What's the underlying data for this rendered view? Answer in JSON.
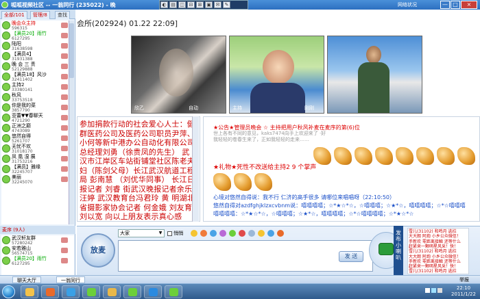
{
  "window": {
    "title": "呱呱视频社区 -- 一翁同行 (235022) - 晚",
    "network_status": "网络状况",
    "controls": [
      "—",
      "□",
      "×"
    ]
  },
  "toolbar": {
    "buttons": [
      "◐",
      "▤",
      "◫",
      "⊟",
      "⊞",
      "▣",
      "✉",
      "✎"
    ]
  },
  "left_panel": {
    "tabs": [
      "全部/101",
      "管理/8",
      "查找"
    ],
    "users": [
      {
        "name": "晚会众主持",
        "id": "596315",
        "color": "#d00"
      },
      {
        "name": "【满员20】雨竹",
        "id": "6127295",
        "color": "#0a0"
      },
      {
        "name": "陆阳",
        "id": "31638598",
        "color": "#000"
      },
      {
        "name": "【满员4】",
        "id": "31931388",
        "color": "#000"
      },
      {
        "name": "晚 会 三 责",
        "id": "52129888",
        "color": "#000"
      },
      {
        "name": "【满员18】风沙",
        "id": "32411402",
        "color": "#000"
      },
      {
        "name": "主持2",
        "id": "33380141",
        "color": "#000"
      },
      {
        "name": "秋风",
        "id": "33753518",
        "color": "#000"
      },
      {
        "name": "你是我的菜",
        "id": "3857790",
        "color": "#000"
      },
      {
        "name": "亚蕾▼▼春聊天",
        "id": "4721290",
        "color": "#000"
      },
      {
        "name": "正洲之巅",
        "id": "4743089",
        "color": "#000"
      },
      {
        "name": "悠然自得",
        "id": "5261707",
        "color": "#000"
      },
      {
        "name": "无忧不欢",
        "id": "31018170",
        "color": "#000"
      },
      {
        "name": "凤 凰 湿 展",
        "id": "31753216",
        "color": "#000"
      },
      {
        "name": "【满员】雅缘",
        "id": "32245707",
        "color": "#000"
      },
      {
        "name": "美丽",
        "id": "32245070",
        "color": "#000"
      }
    ],
    "listeners_label": "麦序 (9人)",
    "listeners": [
      {
        "name": "武汉轩友群",
        "id": "57280242",
        "color": "#000"
      },
      {
        "name": "安若雅山",
        "id": "56574715",
        "color": "#000"
      },
      {
        "name": "【满员20】雨竹",
        "id": "6127295",
        "color": "#0a0"
      }
    ]
  },
  "room": {
    "title": "会所(202924) 01.22 22:09]"
  },
  "videos": [
    {
      "label_left": "欣乙",
      "label_right": "自动"
    },
    {
      "label_left": "主持",
      "label_right": "刚刚"
    },
    {
      "label_left": "",
      "label_right": ""
    }
  ],
  "public_chat": {
    "header_partial": "",
    "text": "参加捐款行动的社会爱心人士：健群医药公司及医药公司职员尹萍、小何等新中港办公自动化有限公司总经理刘勇（徐贵凤的先生） 武汉市江岸区车站街铺堂社区陈老夫妇（陈剑父母）长江武汉航道工程局 彭南慧 （刘优华同事） 长江日报记者 刘睿 街武汉晚报记者余乐 汪婷 武汉教育台冯君玲 黄 明湖北省摄影家协会记者 何金娥 刘友育 刘以宽 向以上朋友表示真心感谢！！"
  },
  "private_chat": {
    "lines": [
      {
        "text": "★公告★管理员晚会 ☆ 主持把用户秋风补麦在麦序的第(6)位",
        "color": "#d00"
      },
      {
        "text": "世上各有不同的意见，kaks7474向手上欢迎来了 ·好",
        "color": "#999"
      },
      {
        "text": "我轻轻的卷春生来了，正如我轻轻的走来……",
        "color": "#999"
      },
      {
        "text": "★礼物★死性不改送给主持2  9 个掌声",
        "color": "#d00"
      },
      {
        "text": "心境对悠然自得说：我不行  仁济的高手很多  请哪位来唱唱呀（22:10:50）",
        "color": "#1a4fc8"
      },
      {
        "text": "悠然自得对azdfghjklzxcvbnm说：嘻嘻嘻嘻；☆*★☆*☆，☆嘻嘻嘻；☆★*☆，嘻嘻嘻嘻；☆*☆嘻嘻嘻",
        "color": "#1a4fc8"
      },
      {
        "text": "嘻嘻嘻嘻：☆*★☆*☆，☆嘻嘻嘻；☆★*☆，嘻嘻嘻嘻；☆*☆嘻嘻嘻嘻；☆*★☆*☆",
        "color": "#1a4fc8"
      }
    ],
    "clap_count": 9
  },
  "input": {
    "mic_label": "放麦",
    "to_target": "大家",
    "secret_label": "悄悄",
    "send_label": "发 送"
  },
  "side_ads": {
    "lines": [
      "雪儿(31102) 和鸣月 选拉",
      "大大朗 阿炮 小乡公众微信！",
      "手新欢 零距离接触 还等什么",
      "赶紧来一颗明星风采！快！",
      "雪儿(31102) 和鸣月 选拉",
      "大大朗 阿炮 小乡公众微信！",
      "手新欢 零距离接触 还等什么",
      "赶紧来一颗明星风采！快！",
      "雪儿(31102) 和鸣月 选拉"
    ]
  },
  "vertical_banner": "发布小喇叭",
  "status_tabs": [
    "聊天大厅",
    "一翁同行"
  ],
  "status_right": "举报",
  "taskbar": {
    "time": "22:10",
    "date": "2011/1/22",
    "apps": [
      {
        "icon": "explorer-icon",
        "color": "#f3c24a"
      },
      {
        "icon": "media-icon",
        "color": "#e86a2a"
      },
      {
        "icon": "ie-icon",
        "color": "#39a0e6"
      },
      {
        "icon": "frog-icon",
        "color": "#6ccf3a"
      },
      {
        "icon": "folder-icon",
        "color": "#e8b84a"
      },
      {
        "icon": "frog-icon",
        "color": "#6ccf3a"
      },
      {
        "icon": "s-icon",
        "color": "#2a8ae0"
      },
      {
        "icon": "frog-icon",
        "color": "#6ccf3a"
      }
    ]
  }
}
